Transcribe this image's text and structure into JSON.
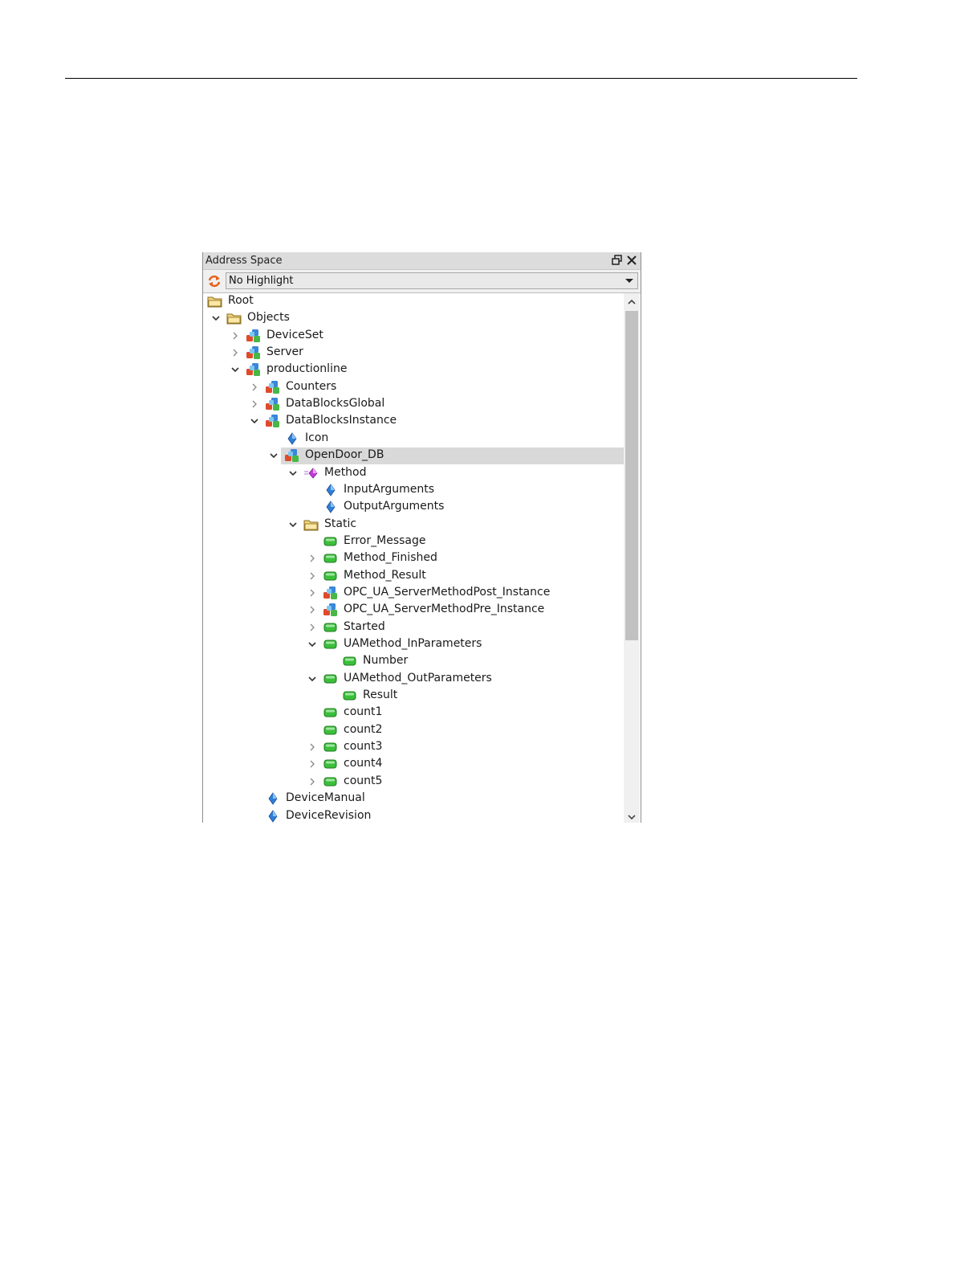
{
  "panel": {
    "title": "Address Space",
    "highlight_value": "No Highlight"
  },
  "tree": [
    {
      "label": "Root",
      "icon": "folder-icon",
      "depth": 0,
      "expander": "none"
    },
    {
      "label": "Objects",
      "icon": "folder-icon",
      "depth": 1,
      "expander": "expanded"
    },
    {
      "label": "DeviceSet",
      "icon": "object-icon",
      "depth": 2,
      "expander": "collapsed"
    },
    {
      "label": "Server",
      "icon": "object-icon",
      "depth": 2,
      "expander": "collapsed"
    },
    {
      "label": "productionline",
      "icon": "object-icon",
      "depth": 2,
      "expander": "expanded"
    },
    {
      "label": "Counters",
      "icon": "object-icon",
      "depth": 3,
      "expander": "collapsed"
    },
    {
      "label": "DataBlocksGlobal",
      "icon": "object-icon",
      "depth": 3,
      "expander": "collapsed"
    },
    {
      "label": "DataBlocksInstance",
      "icon": "object-icon",
      "depth": 3,
      "expander": "expanded"
    },
    {
      "label": "Icon",
      "icon": "property-icon",
      "depth": 4,
      "expander": "none"
    },
    {
      "label": "OpenDoor_DB",
      "icon": "object-icon",
      "depth": 4,
      "expander": "expanded",
      "selected": true
    },
    {
      "label": "Method",
      "icon": "method-icon",
      "depth": 5,
      "expander": "expanded"
    },
    {
      "label": "InputArguments",
      "icon": "property-icon",
      "depth": 6,
      "expander": "none"
    },
    {
      "label": "OutputArguments",
      "icon": "property-icon",
      "depth": 6,
      "expander": "none"
    },
    {
      "label": "Static",
      "icon": "folder-icon",
      "depth": 5,
      "expander": "expanded"
    },
    {
      "label": "Error_Message",
      "icon": "variable-icon",
      "depth": 6,
      "expander": "none"
    },
    {
      "label": "Method_Finished",
      "icon": "variable-icon",
      "depth": 6,
      "expander": "collapsed"
    },
    {
      "label": "Method_Result",
      "icon": "variable-icon",
      "depth": 6,
      "expander": "collapsed"
    },
    {
      "label": "OPC_UA_ServerMethodPost_Instance",
      "icon": "object-icon",
      "depth": 6,
      "expander": "collapsed"
    },
    {
      "label": "OPC_UA_ServerMethodPre_Instance",
      "icon": "object-icon",
      "depth": 6,
      "expander": "collapsed"
    },
    {
      "label": "Started",
      "icon": "variable-icon",
      "depth": 6,
      "expander": "collapsed"
    },
    {
      "label": "UAMethod_InParameters",
      "icon": "variable-icon",
      "depth": 6,
      "expander": "expanded"
    },
    {
      "label": "Number",
      "icon": "variable-icon",
      "depth": 7,
      "expander": "none"
    },
    {
      "label": "UAMethod_OutParameters",
      "icon": "variable-icon",
      "depth": 6,
      "expander": "expanded"
    },
    {
      "label": "Result",
      "icon": "variable-icon",
      "depth": 7,
      "expander": "none"
    },
    {
      "label": "count1",
      "icon": "variable-icon",
      "depth": 6,
      "expander": "none"
    },
    {
      "label": "count2",
      "icon": "variable-icon",
      "depth": 6,
      "expander": "none"
    },
    {
      "label": "count3",
      "icon": "variable-icon",
      "depth": 6,
      "expander": "collapsed"
    },
    {
      "label": "count4",
      "icon": "variable-icon",
      "depth": 6,
      "expander": "collapsed"
    },
    {
      "label": "count5",
      "icon": "variable-icon",
      "depth": 6,
      "expander": "collapsed"
    },
    {
      "label": "DeviceManual",
      "icon": "property-icon",
      "depth": 3,
      "expander": "none"
    },
    {
      "label": "DeviceRevision",
      "icon": "property-icon",
      "depth": 3,
      "expander": "none"
    }
  ],
  "colors": {
    "selection": "#d9d9d9",
    "folder": "#f0d27a",
    "variable": "#3bbf3b",
    "property": "#2f7fd8",
    "method": "#c23bd6"
  }
}
